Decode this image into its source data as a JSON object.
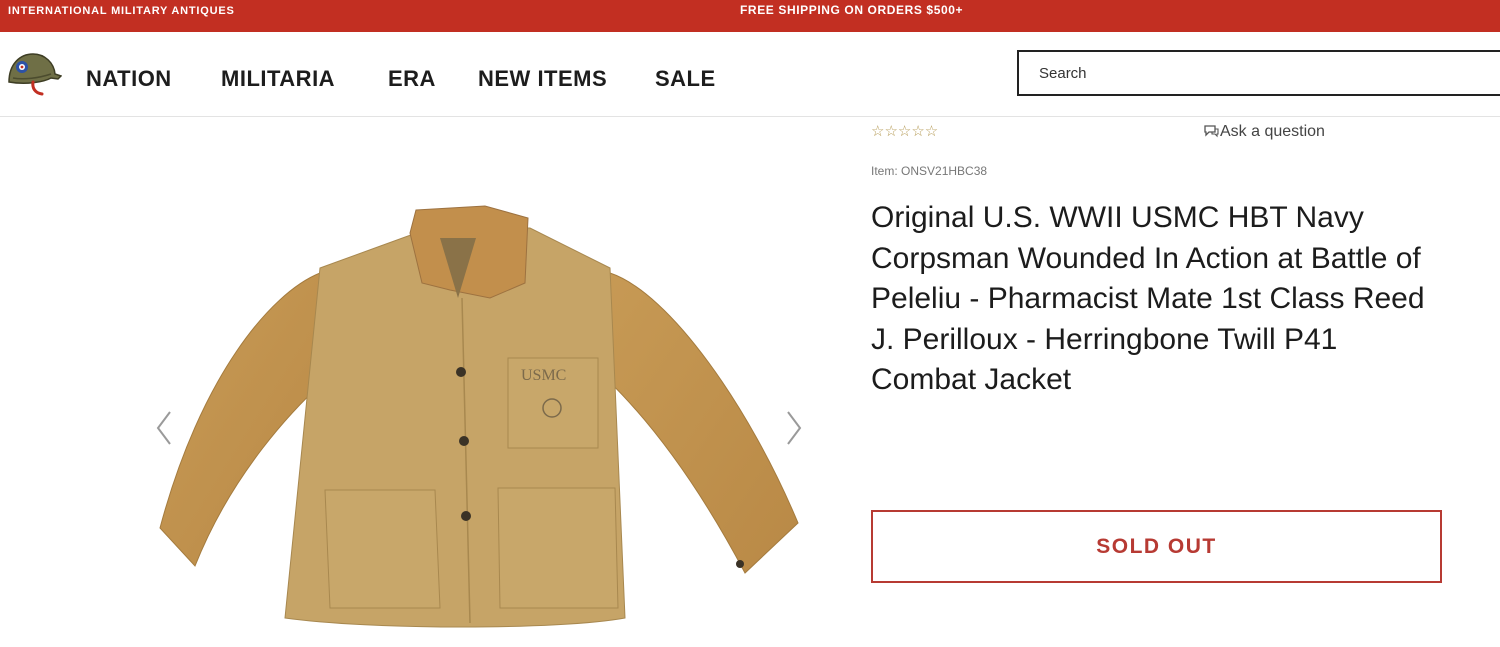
{
  "topbar": {
    "brand": "INTERNATIONAL MILITARY ANTIQUES",
    "promo": "FREE SHIPPING ON ORDERS $500+",
    "color": "#c22f22"
  },
  "header": {
    "logo_icon": "army-helmet-icon",
    "nav": [
      {
        "label": "NATION"
      },
      {
        "label": "MILITARIA"
      },
      {
        "label": "ERA"
      },
      {
        "label": "NEW ITEMS"
      },
      {
        "label": "SALE"
      }
    ],
    "search": {
      "placeholder": "Search",
      "value": ""
    }
  },
  "gallery": {
    "image_icon": "usmc-jacket-photo",
    "image_caption_text": "USMC",
    "prev_icon": "chevron-left-icon",
    "next_icon": "chevron-right-icon"
  },
  "product": {
    "rating_stars": 0,
    "stars_text": "☆☆☆☆☆",
    "ask_label": "Ask a question",
    "ask_icon": "chat-bubble-icon",
    "sku_text": "Item: ONSV21HBC38",
    "title": "Original U.S. WWII USMC HBT Navy Corpsman Wounded In Action at Battle of Peleliu - Pharmacist Mate 1st Class Reed J. Perilloux - Herringbone Twill P41 Combat Jacket",
    "button_label": "SOLD OUT",
    "accent_color": "#b73a33"
  }
}
